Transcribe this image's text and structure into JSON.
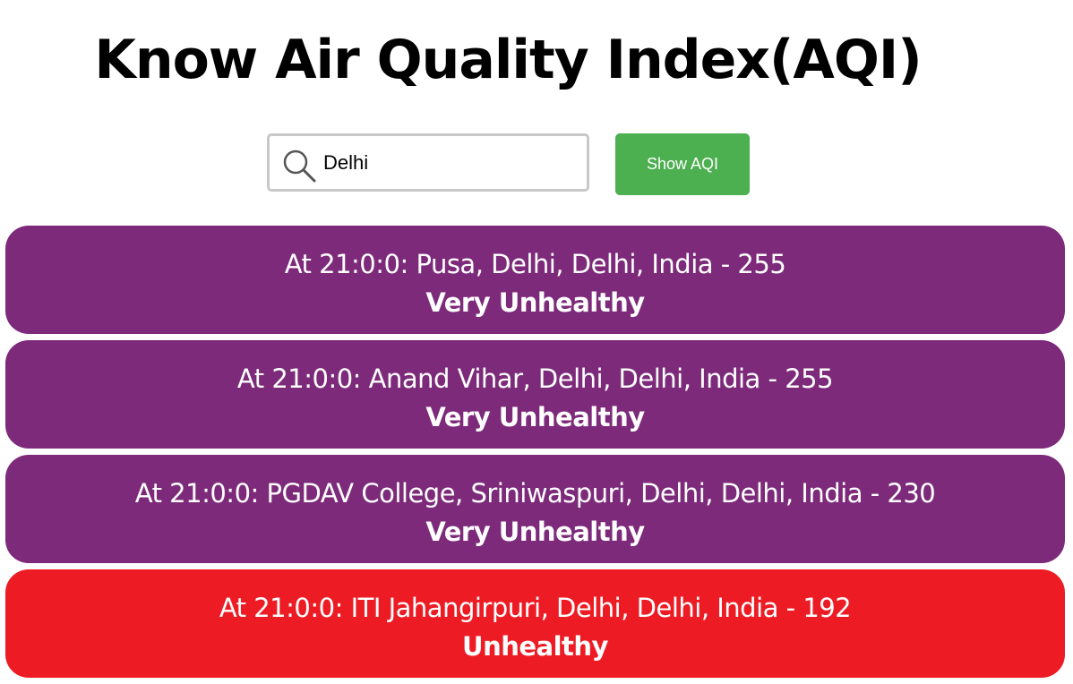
{
  "page": {
    "title": "Know Air Quality Index(AQI)"
  },
  "search": {
    "value": "Delhi",
    "icon": "search-icon",
    "button_label": "Show AQI"
  },
  "colors": {
    "button": "#4caf50",
    "very_unhealthy": "#7d2a7b",
    "unhealthy": "#ed1c24"
  },
  "results": [
    {
      "text": "At 21:0:0: Pusa, Delhi, Delhi, India - 255",
      "category": "Very Unhealthy",
      "color": "#7d2a7b"
    },
    {
      "text": "At 21:0:0: Anand Vihar, Delhi, Delhi, India - 255",
      "category": "Very Unhealthy",
      "color": "#7d2a7b"
    },
    {
      "text": "At 21:0:0: PGDAV College, Sriniwaspuri, Delhi, Delhi, India - 230",
      "category": "Very Unhealthy",
      "color": "#7d2a7b"
    },
    {
      "text": "At 21:0:0: ITI Jahangirpuri, Delhi, Delhi, India - 192",
      "category": "Unhealthy",
      "color": "#ed1c24"
    }
  ]
}
